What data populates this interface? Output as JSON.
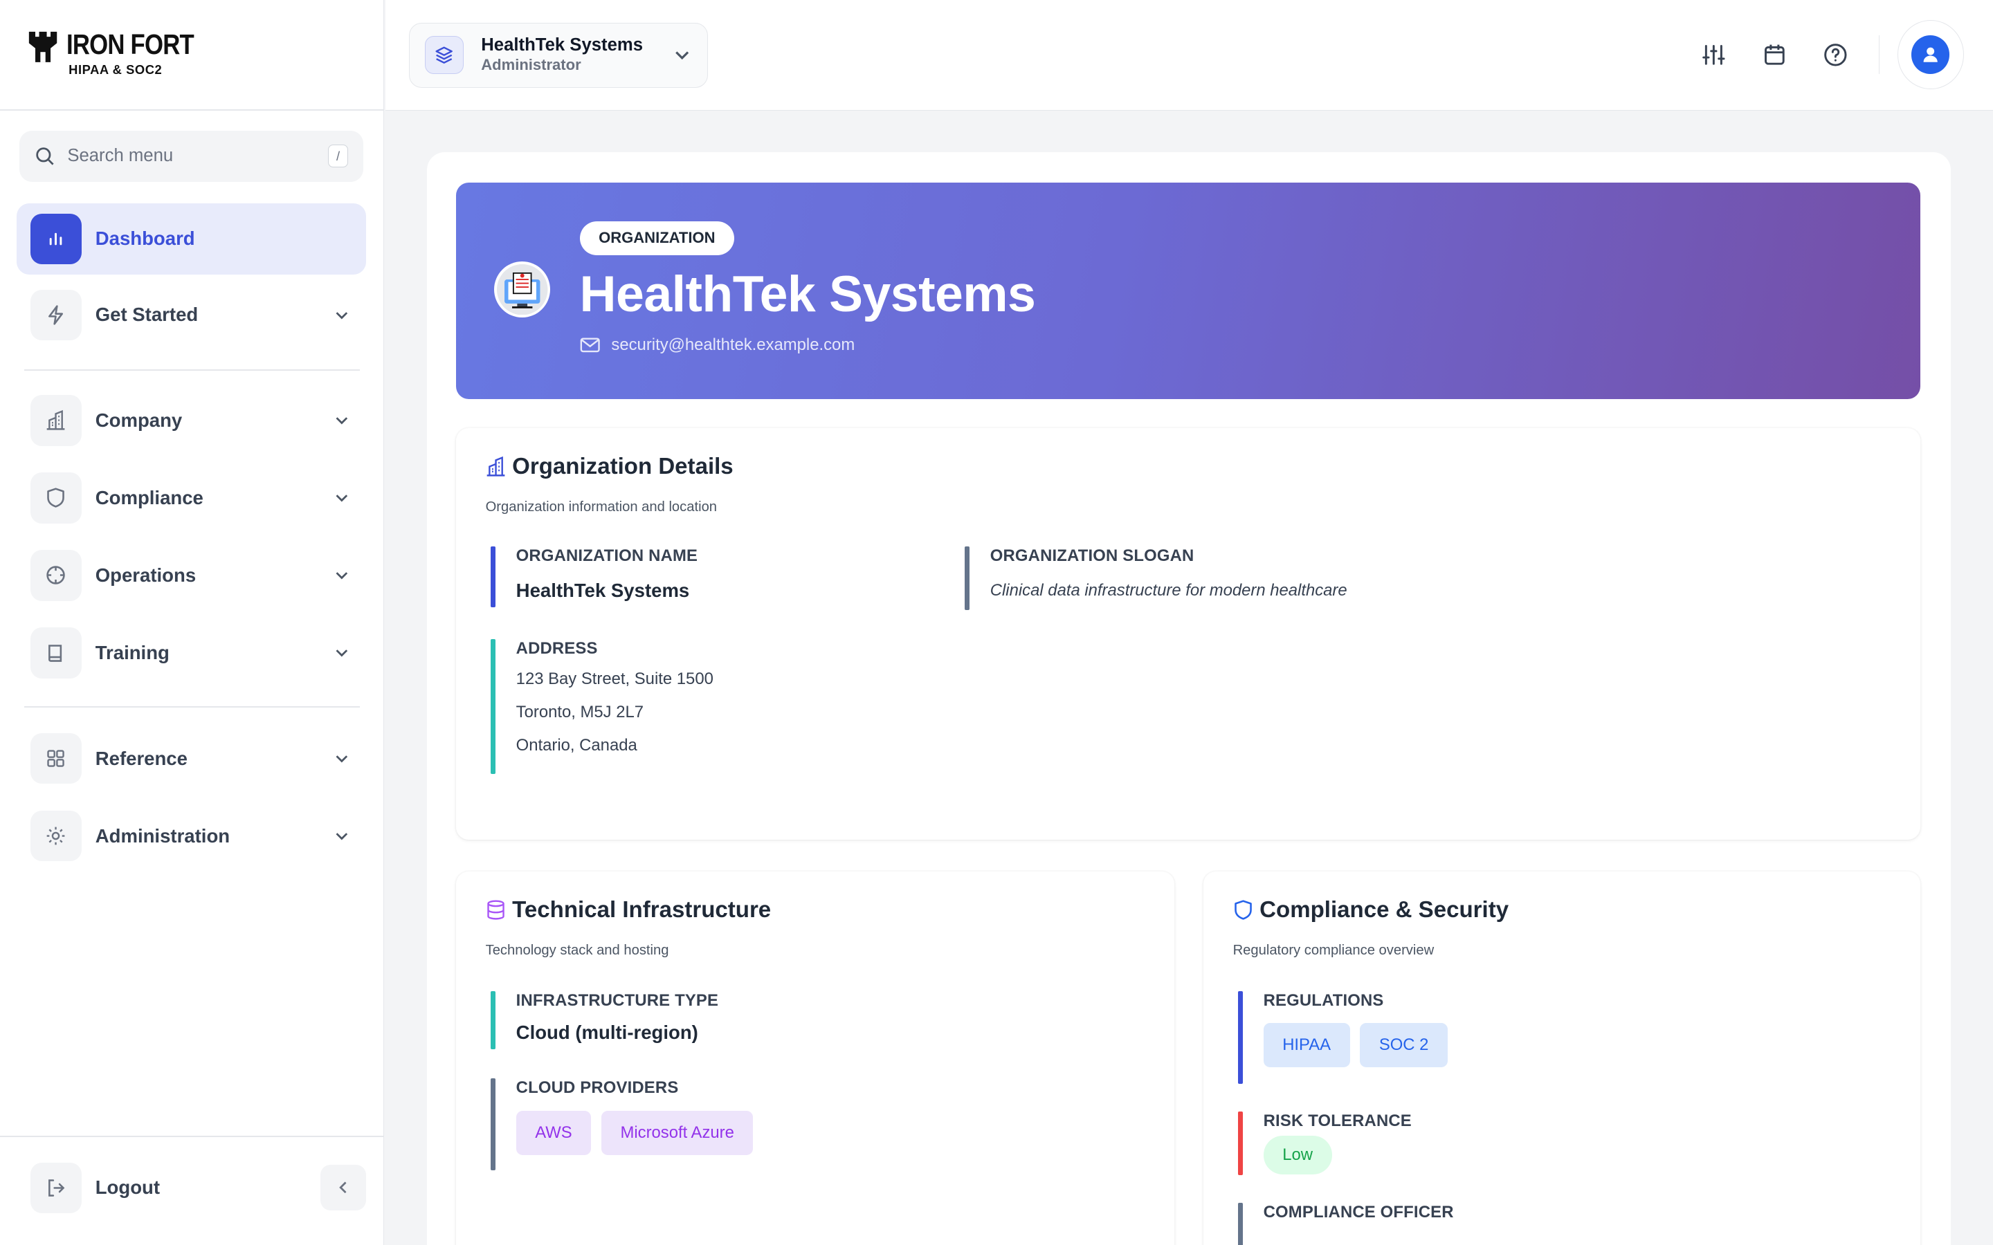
{
  "brand": {
    "name": "IRON FORT",
    "tagline": "HIPAA & SOC2"
  },
  "search": {
    "placeholder": "Search menu",
    "shortcut": "/"
  },
  "sidebar": {
    "items": [
      {
        "label": "Dashboard",
        "icon": "bar-chart-icon",
        "active": true
      },
      {
        "label": "Get Started",
        "icon": "lightning-icon"
      },
      {
        "label": "Company",
        "icon": "building-icon"
      },
      {
        "label": "Compliance",
        "icon": "shield-icon"
      },
      {
        "label": "Operations",
        "icon": "crosshair-icon"
      },
      {
        "label": "Training",
        "icon": "book-icon"
      },
      {
        "label": "Reference",
        "icon": "grid-icon"
      },
      {
        "label": "Administration",
        "icon": "gear-icon"
      }
    ],
    "logout": "Logout"
  },
  "topbar": {
    "org_name": "HealthTek Systems",
    "org_role": "Administrator"
  },
  "hero": {
    "tag": "ORGANIZATION",
    "title": "HealthTek Systems",
    "email": "security@healthtek.example.com"
  },
  "org_details": {
    "title": "Organization Details",
    "subtitle": "Organization information and location",
    "name_label": "ORGANIZATION NAME",
    "name_value": "HealthTek Systems",
    "slogan_label": "ORGANIZATION SLOGAN",
    "slogan_value": "Clinical data infrastructure for modern healthcare",
    "address_label": "ADDRESS",
    "address_lines": [
      "123 Bay Street, Suite 1500",
      "Toronto, M5J 2L7",
      "Ontario, Canada"
    ]
  },
  "tech": {
    "title": "Technical Infrastructure",
    "subtitle": "Technology stack and hosting",
    "infra_label": "INFRASTRUCTURE TYPE",
    "infra_value": "Cloud (multi-region)",
    "cloud_label": "CLOUD PROVIDERS",
    "cloud_providers": [
      "AWS",
      "Microsoft Azure"
    ]
  },
  "compliance": {
    "title": "Compliance & Security",
    "subtitle": "Regulatory compliance overview",
    "regulations_label": "REGULATIONS",
    "regulations": [
      "HIPAA",
      "SOC 2"
    ],
    "risk_label": "RISK TOLERANCE",
    "risk_value": "Low",
    "officer_label": "COMPLIANCE OFFICER"
  },
  "colors": {
    "accent": "#3b4fd8",
    "teal": "#2bbfb3",
    "slate": "#64748b",
    "red": "#ef4444"
  }
}
